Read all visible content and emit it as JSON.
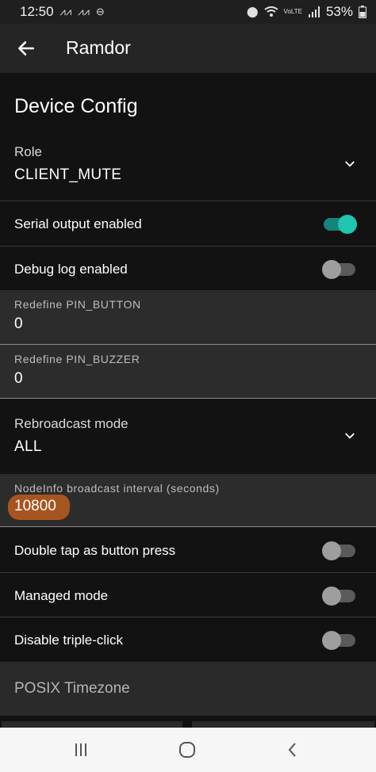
{
  "status_bar": {
    "time": "12:50",
    "battery": "53%",
    "volte": "VoLTE",
    "left_icons": [
      "notification-icon",
      "notification-icon",
      "dnd-icon"
    ],
    "right_icons": [
      "location-icon",
      "wifi-icon",
      "volte-icon",
      "signal-icon",
      "battery-icon"
    ]
  },
  "app_bar": {
    "title": "Ramdor",
    "back_icon": "arrow-left-icon"
  },
  "section": {
    "title": "Device Config"
  },
  "role": {
    "label": "Role",
    "value": "CLIENT_MUTE"
  },
  "toggles": {
    "serial_output": {
      "label": "Serial output enabled",
      "on": true
    },
    "debug_log": {
      "label": "Debug log enabled",
      "on": false
    },
    "double_tap": {
      "label": "Double tap as button press",
      "on": false
    },
    "managed_mode": {
      "label": "Managed mode",
      "on": false
    },
    "triple_click": {
      "label": "Disable triple-click",
      "on": false
    }
  },
  "pin_button": {
    "label": "Redefine PIN_BUTTON",
    "value": "0"
  },
  "pin_buzzer": {
    "label": "Redefine PIN_BUZZER",
    "value": "0"
  },
  "rebroadcast": {
    "label": "Rebroadcast mode",
    "value": "ALL"
  },
  "nodeinfo": {
    "label": "NodeInfo broadcast interval (seconds)",
    "value": "10800"
  },
  "posix": {
    "label": "POSIX Timezone"
  },
  "colors": {
    "accent": "#1ec6b0",
    "background": "#121212",
    "highlight": "#b55a1e"
  },
  "nav_bar": {
    "icons": [
      "recent-apps-icon",
      "home-icon",
      "back-icon"
    ]
  }
}
